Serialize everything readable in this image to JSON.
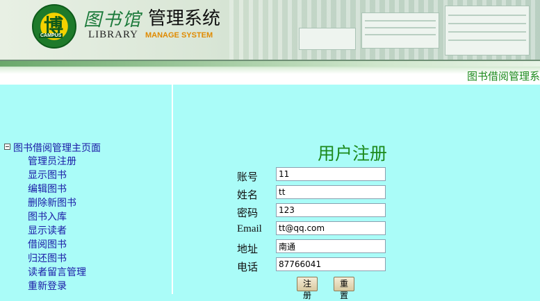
{
  "header": {
    "logo_char": "博",
    "logo_caption": "CAMPUS",
    "brand_script": "图书馆",
    "brand_title": "管理系统",
    "brand_library": "LIBRARY",
    "brand_manage": "MANAGE SYSTEM"
  },
  "subbar": {
    "title": "图书借阅管理系"
  },
  "nav": {
    "root": "图书借阅管理主页面",
    "items": [
      "管理员注册",
      "显示图书",
      "编辑图书",
      "删除新图书",
      "图书入库",
      "显示读者",
      "借阅图书",
      "归还图书",
      "读者留言管理",
      "重新登录"
    ]
  },
  "form": {
    "title": "用户注册",
    "fields": [
      {
        "label": "账号",
        "value": "11"
      },
      {
        "label": "姓名",
        "value": "tt"
      },
      {
        "label": "密码",
        "value": "123"
      },
      {
        "label": "Email",
        "value": "tt@qq.com"
      },
      {
        "label": "地址",
        "value": "南通"
      },
      {
        "label": "电话",
        "value": "87766041"
      }
    ],
    "submit_label": "注册",
    "reset_label": "重置"
  },
  "colors": {
    "background": "#aafcf8",
    "title_green": "#1c8a1c",
    "nav_link": "#1a1aa6"
  }
}
